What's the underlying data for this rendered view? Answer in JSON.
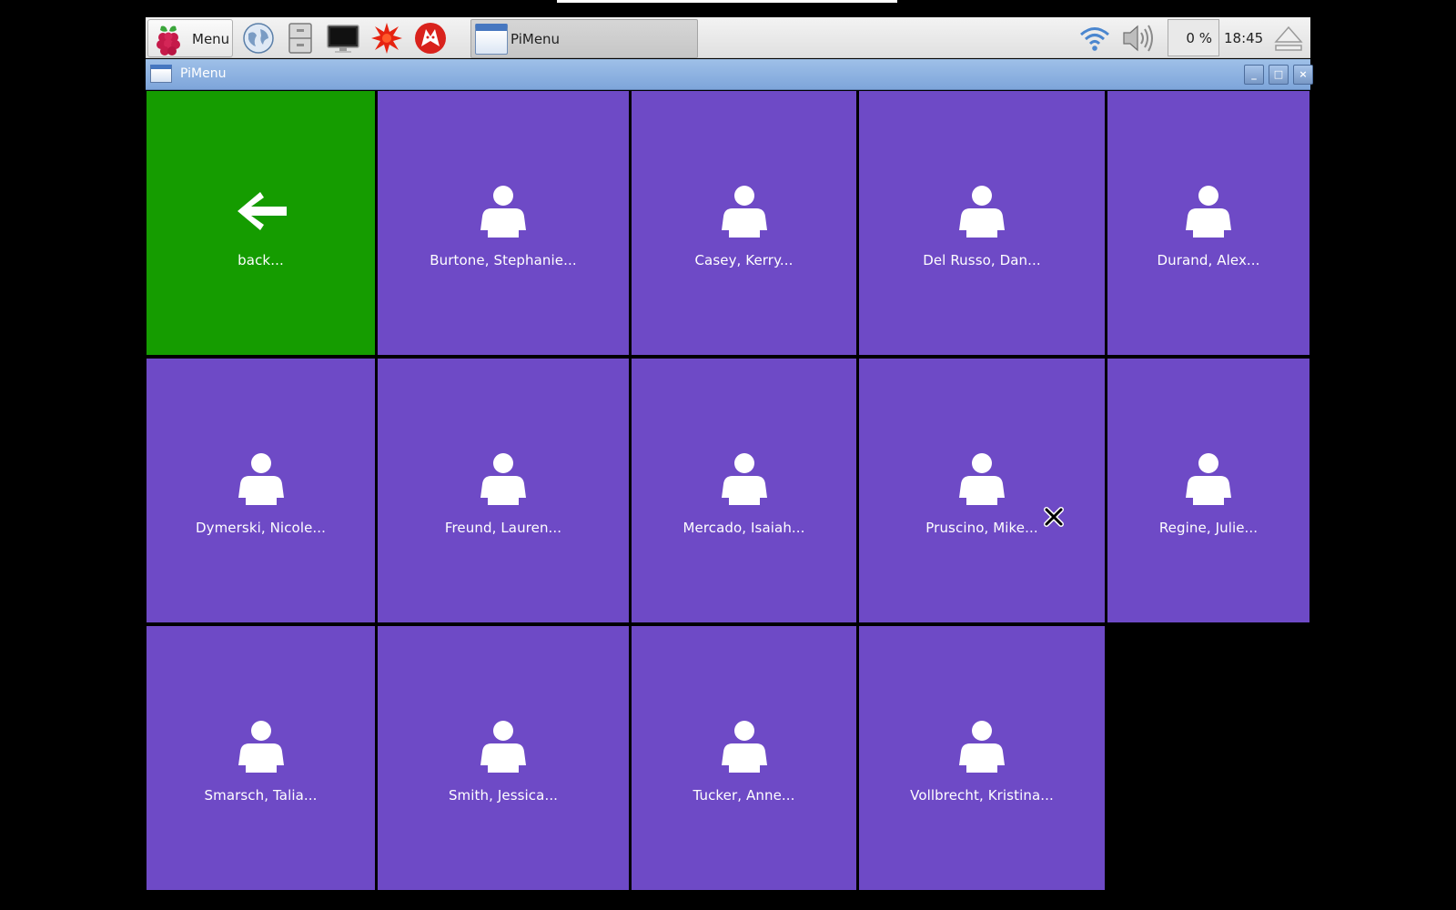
{
  "taskbar": {
    "menu_label": "Menu",
    "launchers": [
      {
        "icon": "web-browser-icon"
      },
      {
        "icon": "file-manager-icon"
      },
      {
        "icon": "terminal-icon"
      },
      {
        "icon": "mathematica-icon"
      },
      {
        "icon": "wolfram-icon"
      }
    ],
    "task_label": "PiMenu",
    "cpu_usage": "0 %",
    "clock": "18:45",
    "tray": [
      {
        "icon": "wifi-icon"
      },
      {
        "icon": "volume-icon"
      },
      {
        "icon": "eject-icon"
      }
    ]
  },
  "window": {
    "title": "PiMenu",
    "buttons": {
      "minimize": "_",
      "maximize": "□",
      "close": "×"
    }
  },
  "tiles": [
    {
      "label": "back...",
      "icon": "back-arrow-icon",
      "color": "#159c00"
    },
    {
      "label": "Burtone, Stephanie...",
      "icon": "person-icon",
      "color": "#6e4ac6"
    },
    {
      "label": "Casey, Kerry...",
      "icon": "person-icon",
      "color": "#6e4ac6"
    },
    {
      "label": "Del Russo, Dan...",
      "icon": "person-icon",
      "color": "#6e4ac6"
    },
    {
      "label": "Durand, Alex...",
      "icon": "person-icon",
      "color": "#6e4ac6"
    },
    {
      "label": "Dymerski, Nicole...",
      "icon": "person-icon",
      "color": "#6e4ac6"
    },
    {
      "label": "Freund, Lauren...",
      "icon": "person-icon",
      "color": "#6e4ac6"
    },
    {
      "label": "Mercado, Isaiah...",
      "icon": "person-icon",
      "color": "#6e4ac6"
    },
    {
      "label": "Pruscino, Mike...",
      "icon": "person-icon",
      "color": "#6e4ac6"
    },
    {
      "label": "Regine, Julie...",
      "icon": "person-icon",
      "color": "#6e4ac6"
    },
    {
      "label": "Smarsch, Talia...",
      "icon": "person-icon",
      "color": "#6e4ac6"
    },
    {
      "label": "Smith, Jessica...",
      "icon": "person-icon",
      "color": "#6e4ac6"
    },
    {
      "label": "Tucker, Anne...",
      "icon": "person-icon",
      "color": "#6e4ac6"
    },
    {
      "label": "Vollbrecht, Kristina...",
      "icon": "person-icon",
      "color": "#6e4ac6"
    }
  ]
}
